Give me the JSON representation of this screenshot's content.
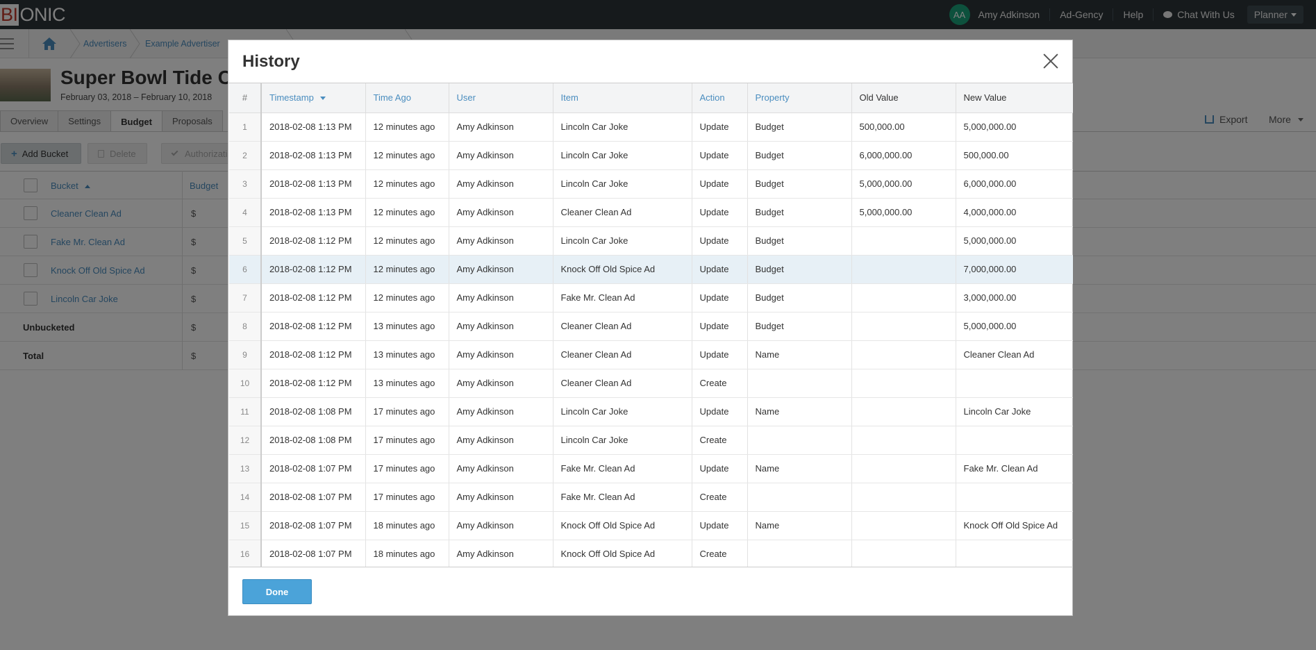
{
  "app": {
    "logo_first": "BI",
    "logo_rest": "ONIC",
    "user_initials": "AA",
    "user_name": "Amy Adkinson",
    "nav": [
      "Ad-Gency",
      "Help",
      "Chat With Us",
      "Planner"
    ]
  },
  "breadcrumb": [
    "Advertisers",
    "Example Advertiser"
  ],
  "header": {
    "title": "Super Bowl Tide C",
    "dates": "February 03, 2018 – February 10, 2018"
  },
  "tabs": [
    "Overview",
    "Settings",
    "Budget",
    "Proposals"
  ],
  "active_tab": "Budget",
  "toolbar": {
    "add_label": "Add Bucket",
    "delete_label": "Delete",
    "authorize_label": "Authorizati",
    "export_label": "Export",
    "more_label": "More"
  },
  "budget_table": {
    "col_bucket": "Bucket",
    "col_budget": "Budget",
    "rows": [
      {
        "name": "Cleaner Clean Ad",
        "currency": "$"
      },
      {
        "name": "Fake Mr. Clean Ad",
        "currency": "$"
      },
      {
        "name": "Knock Off Old Spice Ad",
        "currency": "$"
      },
      {
        "name": "Lincoln Car Joke",
        "currency": "$"
      }
    ],
    "unbucketed_label": "Unbucketed",
    "total_label": "Total",
    "currency": "$"
  },
  "modal": {
    "title": "History",
    "done_label": "Done",
    "columns": [
      "#",
      "Timestamp",
      "Time Ago",
      "User",
      "Item",
      "Action",
      "Property",
      "Old Value",
      "New Value"
    ],
    "rows": [
      [
        "1",
        "2018-02-08 1:13 PM",
        "12 minutes ago",
        "Amy Adkinson",
        "Lincoln Car Joke",
        "Update",
        "Budget",
        "500,000.00",
        "5,000,000.00"
      ],
      [
        "2",
        "2018-02-08 1:13 PM",
        "12 minutes ago",
        "Amy Adkinson",
        "Lincoln Car Joke",
        "Update",
        "Budget",
        "6,000,000.00",
        "500,000.00"
      ],
      [
        "3",
        "2018-02-08 1:13 PM",
        "12 minutes ago",
        "Amy Adkinson",
        "Lincoln Car Joke",
        "Update",
        "Budget",
        "5,000,000.00",
        "6,000,000.00"
      ],
      [
        "4",
        "2018-02-08 1:13 PM",
        "12 minutes ago",
        "Amy Adkinson",
        "Cleaner Clean Ad",
        "Update",
        "Budget",
        "5,000,000.00",
        "4,000,000.00"
      ],
      [
        "5",
        "2018-02-08 1:12 PM",
        "12 minutes ago",
        "Amy Adkinson",
        "Lincoln Car Joke",
        "Update",
        "Budget",
        "",
        "5,000,000.00"
      ],
      [
        "6",
        "2018-02-08 1:12 PM",
        "12 minutes ago",
        "Amy Adkinson",
        "Knock Off Old Spice Ad",
        "Update",
        "Budget",
        "",
        "7,000,000.00"
      ],
      [
        "7",
        "2018-02-08 1:12 PM",
        "12 minutes ago",
        "Amy Adkinson",
        "Fake Mr. Clean Ad",
        "Update",
        "Budget",
        "",
        "3,000,000.00"
      ],
      [
        "8",
        "2018-02-08 1:12 PM",
        "13 minutes ago",
        "Amy Adkinson",
        "Cleaner Clean Ad",
        "Update",
        "Budget",
        "",
        "5,000,000.00"
      ],
      [
        "9",
        "2018-02-08 1:12 PM",
        "13 minutes ago",
        "Amy Adkinson",
        "Cleaner Clean Ad",
        "Update",
        "Name",
        "",
        "Cleaner Clean Ad"
      ],
      [
        "10",
        "2018-02-08 1:12 PM",
        "13 minutes ago",
        "Amy Adkinson",
        "Cleaner Clean Ad",
        "Create",
        "",
        "",
        ""
      ],
      [
        "11",
        "2018-02-08 1:08 PM",
        "17 minutes ago",
        "Amy Adkinson",
        "Lincoln Car Joke",
        "Update",
        "Name",
        "",
        "Lincoln Car Joke"
      ],
      [
        "12",
        "2018-02-08 1:08 PM",
        "17 minutes ago",
        "Amy Adkinson",
        "Lincoln Car Joke",
        "Create",
        "",
        "",
        ""
      ],
      [
        "13",
        "2018-02-08 1:07 PM",
        "17 minutes ago",
        "Amy Adkinson",
        "Fake Mr. Clean Ad",
        "Update",
        "Name",
        "",
        "Fake Mr. Clean Ad"
      ],
      [
        "14",
        "2018-02-08 1:07 PM",
        "17 minutes ago",
        "Amy Adkinson",
        "Fake Mr. Clean Ad",
        "Create",
        "",
        "",
        ""
      ],
      [
        "15",
        "2018-02-08 1:07 PM",
        "18 minutes ago",
        "Amy Adkinson",
        "Knock Off Old Spice Ad",
        "Update",
        "Name",
        "",
        "Knock Off Old Spice Ad"
      ],
      [
        "16",
        "2018-02-08 1:07 PM",
        "18 minutes ago",
        "Amy Adkinson",
        "Knock Off Old Spice Ad",
        "Create",
        "",
        "",
        ""
      ]
    ],
    "highlighted_row": 6
  },
  "colors": {
    "topbar": "#2d3539",
    "link": "#4a8dbf",
    "primary_button": "#4ba3d9",
    "avatar": "#1aa37a",
    "logo_red": "#c0392b",
    "row_highlight": "#e7f0f6"
  }
}
